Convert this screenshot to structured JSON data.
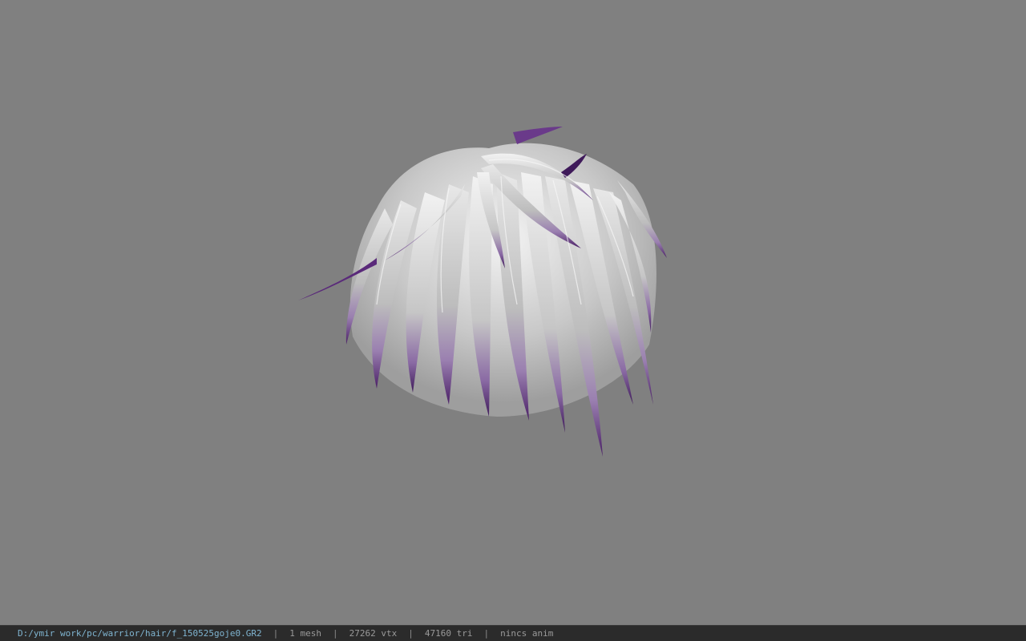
{
  "viewer": {
    "background_color": "#808080",
    "model": {
      "type": "hair-mesh",
      "base_color": "#d0d0d0",
      "tip_color": "#5a2a7a"
    }
  },
  "status_bar": {
    "file_path": "D:/ymir work/pc/warrior/hair/f_150525goje0.GR2",
    "separator": "|",
    "mesh_count": "1 mesh",
    "vertex_count": "27262 vtx",
    "triangle_count": "47160 tri",
    "animation": "nincs anim"
  }
}
